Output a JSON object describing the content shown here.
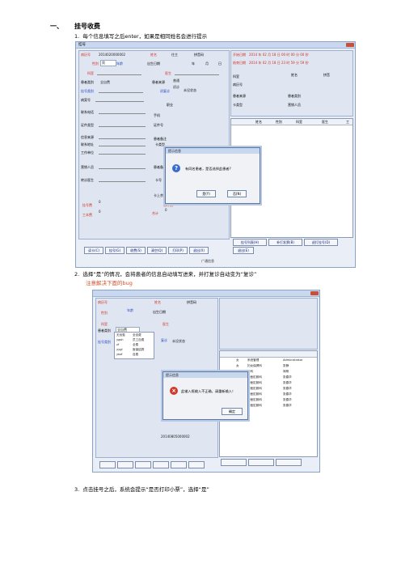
{
  "section": {
    "number": "一、",
    "title": "挂号收费"
  },
  "steps": [
    {
      "number": "1.",
      "text": "每个信息填写之后enter，如果是相同姓名会进行提示"
    },
    {
      "number": "2.",
      "text": "选择“是”的情况，会将患者的信息自动填写进来，并打复诊自动变为“复诊”",
      "note": "注意解决下面的bug"
    },
    {
      "number": "3.",
      "text": "点击挂号之后，系统会提示“是否打印小票”，选择“是”"
    }
  ],
  "window1": {
    "title": "挂号",
    "fields": {
      "case_no_label": "病历号",
      "case_no_value": "2014020000002",
      "name_label": "姓名",
      "name_value": "往主",
      "pinyin_label": "拼音码",
      "gender_label": "性别",
      "gender_value": "男",
      "age_label": "年龄",
      "birth_label": "出生日期",
      "year_label": "年",
      "month_label": "月",
      "day_label": "日",
      "dept_label": "科室",
      "doctor_label": "医生",
      "patient_type_label": "患者类别",
      "patient_type_value": "全自费",
      "patient_src_label": "患者来源",
      "patient_src_value": "普通",
      "reg_type_label": "挂号类别",
      "recheck_label": "初复诊",
      "recheck_value": "初诊",
      "reg_status_label": "状态",
      "reg_status_value": "未设状态",
      "case_label": "病案号",
      "job_label": "职业",
      "phone_label": "联系电话",
      "mobile_label": "手机",
      "id_type_label": "证件类型",
      "id_no_label": "证件号",
      "source_label": "信息来源",
      "patient_mgr_label": "患者备注",
      "addr_label": "联系地址",
      "card_type_label": "卡类型",
      "work_label": "工作单位",
      "market_label": "营销人员",
      "transfer_label": "转诊医生",
      "card_no_label": "卡号",
      "card_balance_label": "卡上余额",
      "yuan_label": "元",
      "reg_fee_label": "挂号费",
      "reg_fee_value": "0",
      "diag_fee_label": "诊疗费",
      "diag_fee_value": "0",
      "work_fee_label": "工本费",
      "work_fee_value": "0",
      "total_label": "合计",
      "total_value": "0"
    },
    "right": {
      "start_label": "开始日期",
      "start_value": "2014 年 02 月 18 日 00 时 00 分 00 秒",
      "end_label": "结束日期",
      "end_value": "2014 年 02 月 18 日 23 时 59 分 59 秒",
      "dept_label": "科室",
      "name_label": "姓名",
      "pinyin_label": "拼音",
      "case_label": "病历号",
      "src_label": "患者来源",
      "type_label": "患者类别",
      "card_label": "卡类型",
      "market_label": "营销人员"
    },
    "grid_cols": [
      "姓名",
      "性别",
      "科室",
      "医生",
      "工"
    ],
    "buttons_left": [
      "读卡(C)",
      "挂号(G)",
      "收费(S)",
      "清空(Q)",
      "打印(P)",
      "退出(X)"
    ],
    "buttons_right": [
      "挂号列表(H)",
      "补打发票(B)",
      "退打挂号(D)"
    ],
    "exit_button": "退出(E)",
    "status": "广通信息",
    "dialog": {
      "title": "提示信息",
      "message": "有同名患者，是否选择此患者?",
      "yes": "是(Y)",
      "no": "否(N)"
    }
  },
  "window2": {
    "fields": {
      "case_no_label": "病历号",
      "name_label": "姓名",
      "pinyin_label": "拼音码",
      "gender_label": "性别",
      "age_label": "年龄",
      "birth_label": "出生日期",
      "dept_label": "科室",
      "doctor_label": "医生",
      "patient_type_label": "患者类别",
      "patient_type_value": "全自费",
      "reg_type_label": "挂号类别",
      "recheck_label": "复诊",
      "reg_status_value": "未设状态",
      "card_no_value": "20140805000002"
    },
    "list_rows": [
      "无优惠",
      "ygsh",
      "zf",
      "yygl",
      "ybzf"
    ],
    "list_rows_b": [
      "全自费",
      "员工自费",
      "全费",
      "医保结算",
      "自费"
    ],
    "grid_rows": [
      [
        "女",
        "系统管理",
        "Administrator"
      ],
      [
        "女",
        "妇女保健科",
        "张静"
      ],
      [
        "男",
        "外科",
        "熊杨"
      ],
      [
        "男",
        "中医肛肠科",
        "张春华"
      ],
      [
        "男",
        "中医肛肠科",
        "张春华"
      ],
      [
        "男",
        "中医肛肠科",
        "张春华"
      ],
      [
        "男",
        "中医肛肠科",
        "张春华"
      ],
      [
        "男",
        "中医肛肠科",
        "张春华"
      ],
      [
        "男",
        "中医肛肠科",
        "张春华"
      ]
    ],
    "dialog": {
      "title": "提示信息",
      "message": "此输入框输入不正确，请重新输入！",
      "ok": "确定"
    }
  },
  "colors": {
    "accent": "#d03020",
    "link": "#2040c0",
    "window_bg": "#e9eef7"
  }
}
